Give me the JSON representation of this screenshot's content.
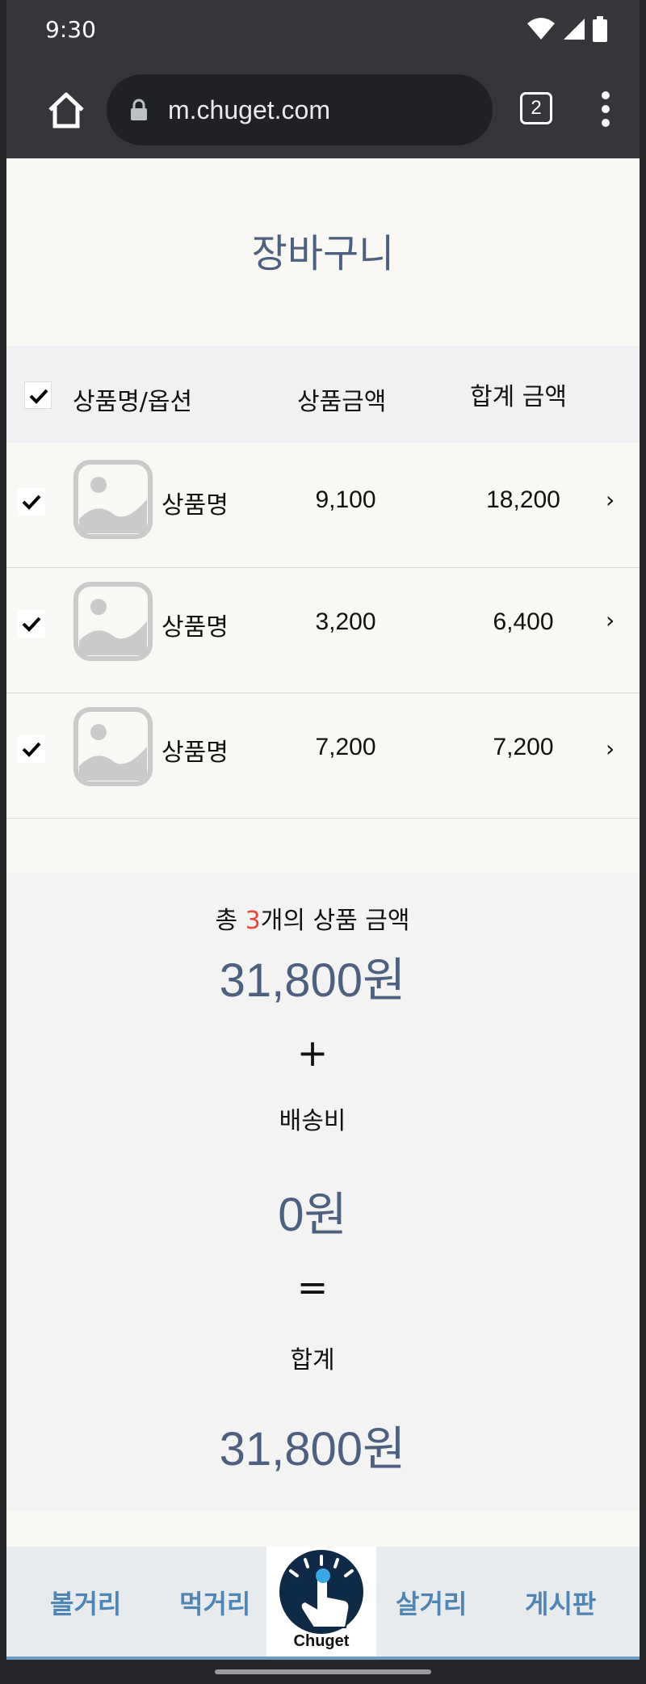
{
  "status_bar": {
    "time": "9:30"
  },
  "browser": {
    "url": "m.chuget.com",
    "tab_count": "2"
  },
  "page": {
    "title": "장바구니",
    "table_header": {
      "name_option": "상품명/옵션",
      "price": "상품금액",
      "total": "합계 금액"
    },
    "items": [
      {
        "name": "상품명",
        "price": "9,100",
        "total": "18,200",
        "arrow": "›"
      },
      {
        "name": "상품명",
        "price": "3,200",
        "total": "6,400",
        "arrow": "›"
      },
      {
        "name": "상품명",
        "price": "7,200",
        "total": "7,200",
        "arrow": "›"
      }
    ],
    "summary": {
      "count_prefix": "총 ",
      "count": "3",
      "count_suffix": "개의 상품 금액",
      "subtotal": "31,800원",
      "plus": "+",
      "shipping_label": "배송비",
      "shipping": "0원",
      "equals": "=",
      "total_label": "합계",
      "total": "31,800원"
    }
  },
  "bottom_nav": {
    "items": [
      "볼거리",
      "먹거리",
      "살거리",
      "게시판"
    ],
    "logo_text": "Chuget"
  },
  "colors": {
    "accent": "#4e6080",
    "nav_text": "#4f85b5",
    "count_red": "#e8463c"
  }
}
